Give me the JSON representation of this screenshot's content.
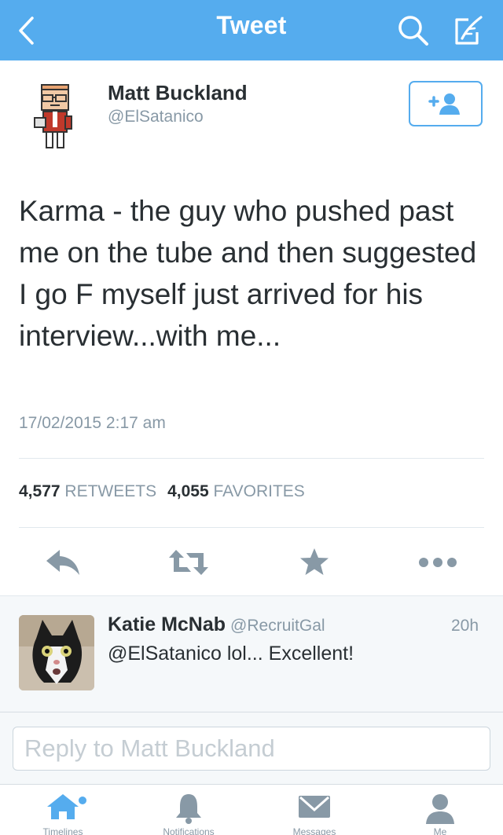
{
  "header": {
    "title": "Tweet"
  },
  "tweet": {
    "name": "Matt Buckland",
    "handle": "@ElSatanico",
    "text": "Karma - the guy who pushed past me on the tube and then suggested I go F myself just arrived for his interview...with me...",
    "timestamp": "17/02/2015 2:17 am",
    "retweet_count": "4,577",
    "retweet_label": "RETWEETS",
    "favorite_count": "4,055",
    "favorite_label": "FAVORITES"
  },
  "reply": {
    "name": "Katie McNab",
    "handle": "@RecruitGal",
    "time": "20h",
    "text": "@ElSatanico lol... Excellent!"
  },
  "reply_input": {
    "placeholder": "Reply to Matt Buckland"
  },
  "tabbar": {
    "items": [
      {
        "label": "Timelines",
        "icon": "home-icon"
      },
      {
        "label": "Notifications",
        "icon": "bell-icon"
      },
      {
        "label": "Messages",
        "icon": "envelope-icon"
      },
      {
        "label": "Me",
        "icon": "person-icon"
      }
    ]
  },
  "colors": {
    "brand": "#55acee",
    "text": "#292f33",
    "muted": "#8899a6",
    "icon": "#8899a6"
  }
}
